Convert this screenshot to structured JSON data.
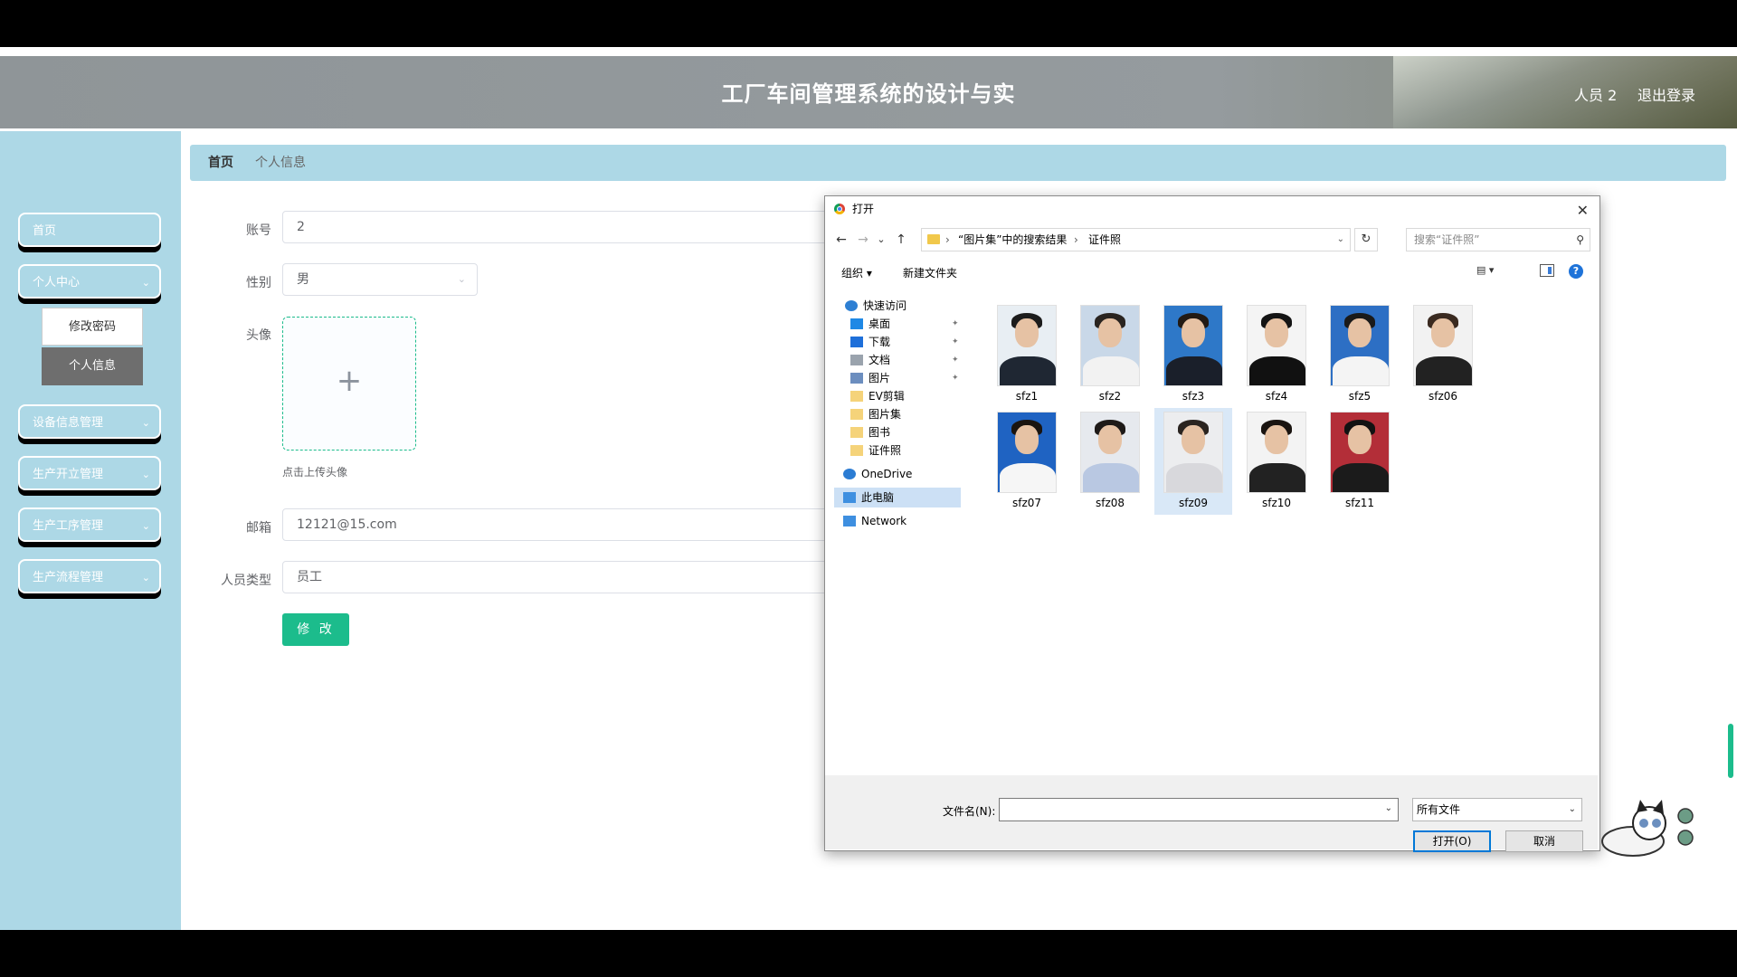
{
  "header": {
    "title": "工厂车间管理系统的设计与实",
    "user": "人员 2",
    "logout": "退出登录"
  },
  "sidebar": {
    "items": [
      {
        "label": "首页"
      },
      {
        "label": "个人中心"
      },
      {
        "label": "设备信息管理"
      },
      {
        "label": "生产开立管理"
      },
      {
        "label": "生产工序管理"
      },
      {
        "label": "生产流程管理"
      }
    ],
    "submenu": [
      "修改密码",
      "个人信息"
    ]
  },
  "breadcrumb": {
    "home": "首页",
    "current": "个人信息"
  },
  "form": {
    "account_label": "账号",
    "account_value": "2",
    "gender_label": "性别",
    "gender_value": "男",
    "avatar_label": "头像",
    "upload_plus": "+",
    "upload_tip": "点击上传头像",
    "email_label": "邮箱",
    "email_value": "12121@15.com",
    "type_label": "人员类型",
    "type_value": "员工",
    "submit": "修 改"
  },
  "dialog": {
    "title": "打开",
    "close": "✕",
    "nav": {
      "back": "←",
      "forward": "→",
      "recent": "⌄",
      "up": "↑",
      "refresh": "↻"
    },
    "path": [
      "“图片集”中的搜索结果",
      "证件照"
    ],
    "path_sep": "›",
    "search_placeholder": "搜索“证件照”",
    "toolbar": {
      "organize": "组织 ▾",
      "new_folder": "新建文件夹",
      "view": "▤ ▾",
      "help": "?"
    },
    "nav_pane": [
      {
        "label": "快速访问",
        "icon": "star-icon",
        "color": "#2d7fd3"
      },
      {
        "label": "桌面",
        "icon": "desktop-icon",
        "color": "#1e88e5",
        "pinned": true
      },
      {
        "label": "下载",
        "icon": "download-icon",
        "color": "#1e6fd9",
        "pinned": true
      },
      {
        "label": "文档",
        "icon": "document-icon",
        "color": "#9aa3ad",
        "pinned": true
      },
      {
        "label": "图片",
        "icon": "picture-icon",
        "color": "#6c8ebf",
        "pinned": true
      },
      {
        "label": "EV剪辑",
        "icon": "folder-icon",
        "color": "#f5d37a"
      },
      {
        "label": "图片集",
        "icon": "folder-icon",
        "color": "#f5d37a"
      },
      {
        "label": "图书",
        "icon": "folder-icon",
        "color": "#f5d37a"
      },
      {
        "label": "证件照",
        "icon": "folder-icon",
        "color": "#f5d37a"
      },
      {
        "label": "OneDrive",
        "icon": "cloud-icon",
        "color": "#2b7cd3"
      },
      {
        "label": "此电脑",
        "icon": "computer-icon",
        "color": "#3e8fe0"
      },
      {
        "label": "Network",
        "icon": "network-icon",
        "color": "#3e8fe0"
      }
    ],
    "pin_glyph": "✦",
    "files": [
      {
        "name": "sfz1",
        "bg": "#e8eef3",
        "hair": "#1c1c1c",
        "body": "#1f2733"
      },
      {
        "name": "sfz2",
        "bg": "#c9d8e8",
        "hair": "#2a2420",
        "body": "#f2f2f2"
      },
      {
        "name": "sfz3",
        "bg": "#2e78c8",
        "hair": "#221a14",
        "body": "#1a1f2a"
      },
      {
        "name": "sfz4",
        "bg": "#f4f4f4",
        "hair": "#141414",
        "body": "#111111"
      },
      {
        "name": "sfz5",
        "bg": "#2d6fc4",
        "hair": "#1a1a1a",
        "body": "#f4f4f4"
      },
      {
        "name": "sfz06",
        "bg": "#f2f2f2",
        "hair": "#3a2a20",
        "body": "#222222"
      },
      {
        "name": "sfz07",
        "bg": "#1f63c2",
        "hair": "#1a1410",
        "body": "#f6f6f6"
      },
      {
        "name": "sfz08",
        "bg": "#e6e9ee",
        "hair": "#1e1a18",
        "body": "#b9c8e2"
      },
      {
        "name": "sfz09",
        "bg": "#ecedef",
        "hair": "#2a2420",
        "body": "#d8d8dc"
      },
      {
        "name": "sfz10",
        "bg": "#f3f3f3",
        "hair": "#1a1410",
        "body": "#222222"
      },
      {
        "name": "sfz11",
        "bg": "#b32e38",
        "hair": "#121212",
        "body": "#1b1b1b"
      }
    ],
    "selected_file": "sfz09",
    "filename_label": "文件名(N):",
    "filename_value": "",
    "file_type": "所有文件",
    "open_button": "打开(O)",
    "cancel_button": "取消"
  }
}
